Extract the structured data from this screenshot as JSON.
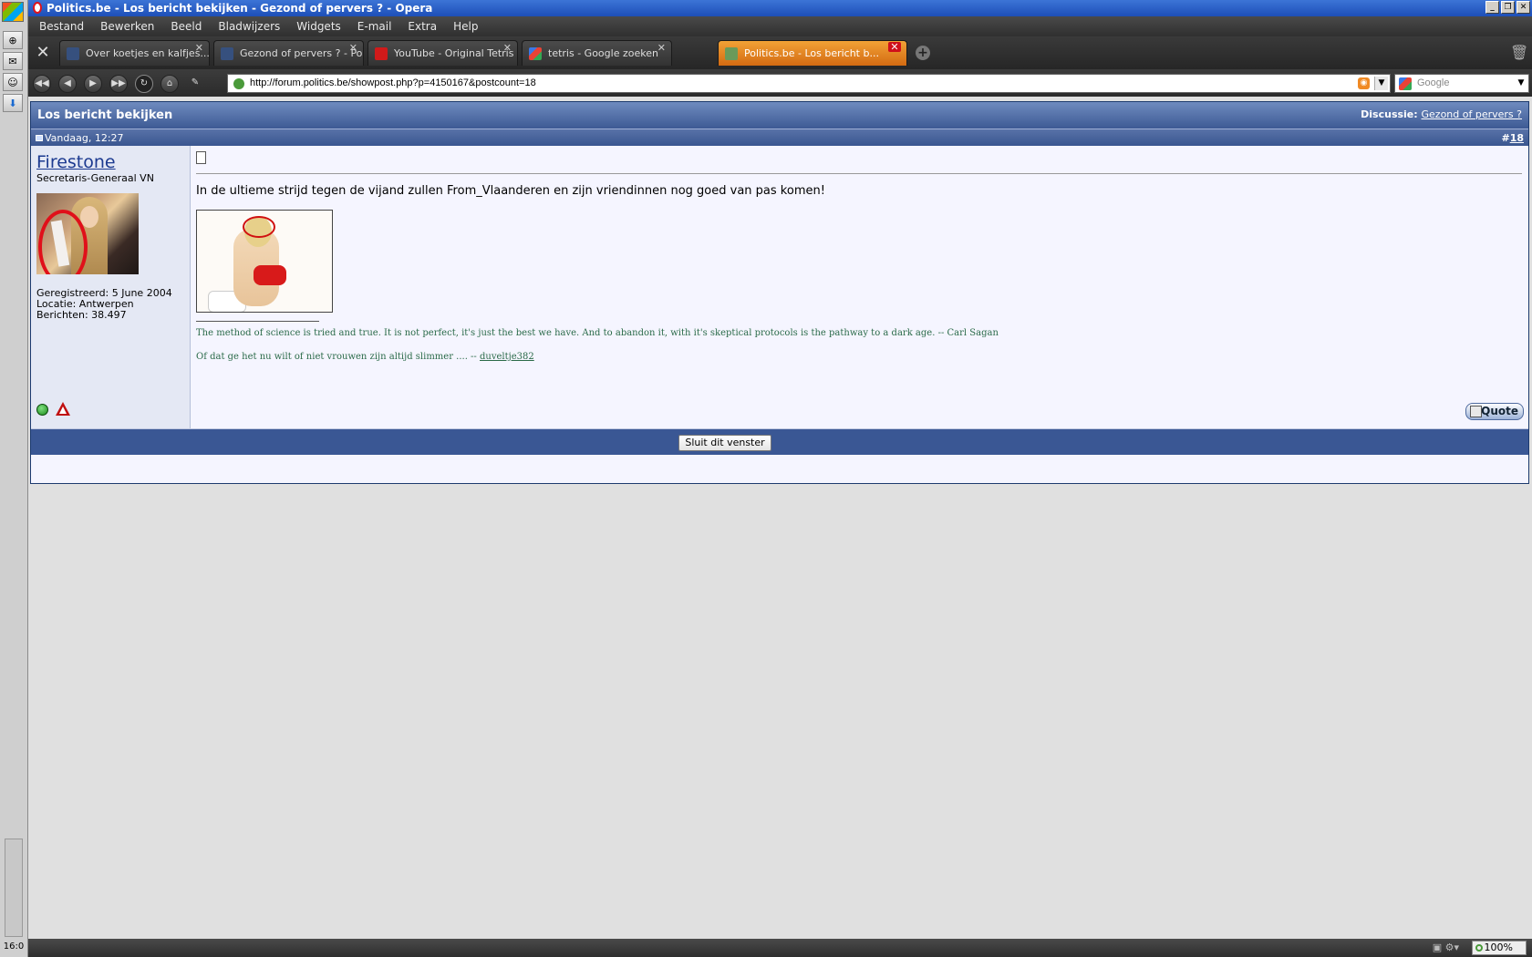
{
  "window": {
    "title": "Politics.be - Los bericht bekijken - Gezond of pervers ? - Opera",
    "controls": [
      "_",
      "❐",
      "✕"
    ]
  },
  "menu": [
    "Bestand",
    "Bewerken",
    "Beeld",
    "Bladwijzers",
    "Widgets",
    "E-mail",
    "Extra",
    "Help"
  ],
  "tabs": [
    {
      "label": "Over koetjes en kalfjes... ...",
      "close": "✕"
    },
    {
      "label": "Gezond of pervers ? - Pol...",
      "close": "✕"
    },
    {
      "label": "YouTube - Original Tetris ...",
      "close": "✕"
    },
    {
      "label": "tetris - Google zoeken",
      "close": "✕"
    },
    {
      "label": "Politics.be - Los bericht b...",
      "close": "✕"
    }
  ],
  "nav": {
    "address": "http://forum.politics.be/showpost.php?p=4150167&postcount=18",
    "search_placeholder": "Google"
  },
  "page": {
    "header_title": "Los bericht bekijken",
    "discussion_label": "Discussie:",
    "discussion_link": "Gezond of pervers ?",
    "post_date": "Vandaag, 12:27",
    "post_number_prefix": "#",
    "post_number": "18",
    "user": {
      "name": "Firestone",
      "title": "Secretaris-Generaal VN",
      "registered": "Geregistreerd: 5 June 2004",
      "location": "Locatie: Antwerpen",
      "posts": "Berichten: 38.497"
    },
    "post_text": "In de ultieme strijd tegen de vijand zullen From_Vlaanderen en zijn vriendinnen nog goed van pas komen!",
    "signature_line1": "The method of science is tried and true. It is not perfect, it's just the best we have. And to abandon it, with it's skeptical protocols is the pathway to a dark age. -- Carl Sagan",
    "signature_line2_text": "Of dat ge het nu wilt of niet vrouwen zijn altijd slimmer .... -- ",
    "signature_line2_link": "duveltje382",
    "quote_label": "Quote",
    "close_window": "Sluit dit venster"
  },
  "status": {
    "zoom": "100%",
    "clock": "16:0"
  },
  "colors": {
    "header_blue": "#3d5a94",
    "active_tab": "#d36a12",
    "post_bg": "#f5f5ff",
    "signature": "#2a6a48"
  }
}
